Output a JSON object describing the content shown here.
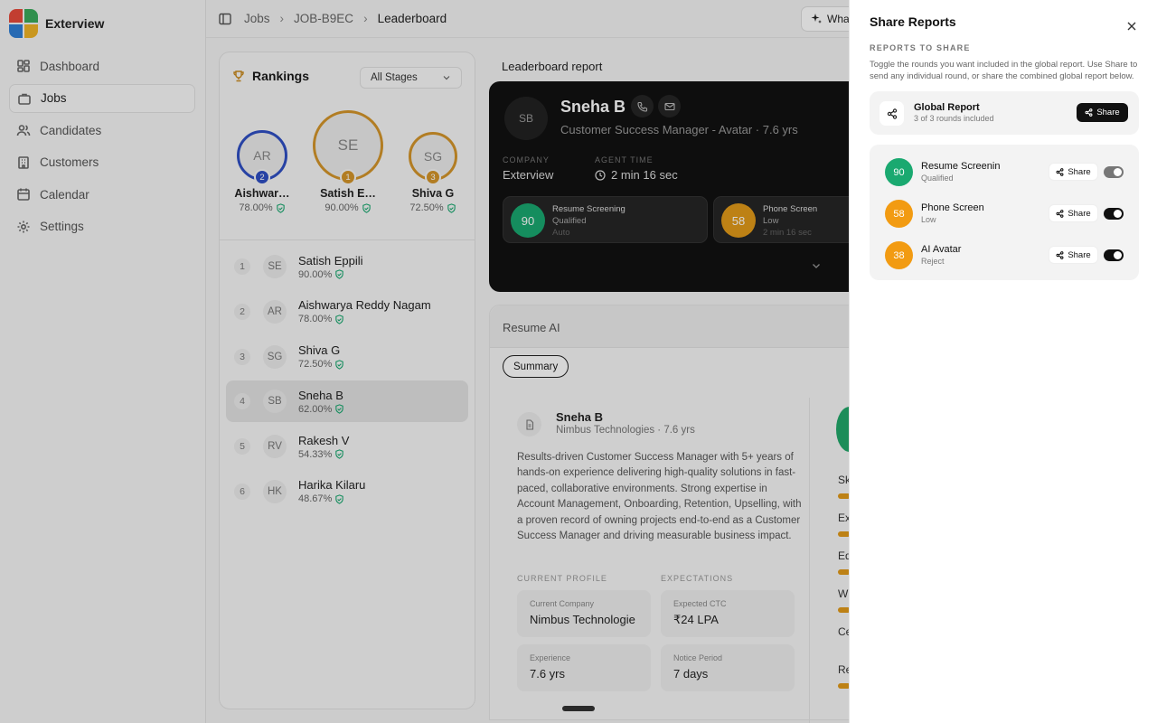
{
  "brand": {
    "name": "Exterview"
  },
  "nav": [
    {
      "label": "Dashboard",
      "icon": "dashboard-icon"
    },
    {
      "label": "Jobs",
      "icon": "briefcase-icon",
      "active": true
    },
    {
      "label": "Candidates",
      "icon": "users-icon"
    },
    {
      "label": "Customers",
      "icon": "building-icon"
    },
    {
      "label": "Calendar",
      "icon": "calendar-icon"
    },
    {
      "label": "Settings",
      "icon": "gear-icon"
    }
  ],
  "breadcrumb": {
    "items": [
      "Jobs",
      "JOB-B9EC",
      "Leaderboard"
    ]
  },
  "topbar": {
    "what_button": "Wha"
  },
  "rankings": {
    "title": "Rankings",
    "stage_select": "All Stages",
    "podium": [
      {
        "rank": "2",
        "initials": "AR",
        "name": "Aishwar…",
        "score": "78.00%"
      },
      {
        "rank": "1",
        "initials": "SE",
        "name": "Satish E…",
        "score": "90.00%"
      },
      {
        "rank": "3",
        "initials": "SG",
        "name": "Shiva G",
        "score": "72.50%"
      }
    ],
    "list": [
      {
        "rank": "1",
        "initials": "SE",
        "name": "Satish Eppili",
        "score": "90.00%"
      },
      {
        "rank": "2",
        "initials": "AR",
        "name": "Aishwarya Reddy Nagam",
        "score": "78.00%"
      },
      {
        "rank": "3",
        "initials": "SG",
        "name": "Shiva G",
        "score": "72.50%"
      },
      {
        "rank": "4",
        "initials": "SB",
        "name": "Sneha B",
        "score": "62.00%",
        "selected": true
      },
      {
        "rank": "5",
        "initials": "RV",
        "name": "Rakesh V",
        "score": "54.33%"
      },
      {
        "rank": "6",
        "initials": "HK",
        "name": "Harika Kilaru",
        "score": "48.67%"
      }
    ]
  },
  "leaderboard": {
    "title": "Leaderboard report",
    "candidate": {
      "initials": "SB",
      "name": "Sneha B",
      "role": "Customer Success Manager - Avatar · 7.6 yrs",
      "company_label": "COMPANY",
      "company": "Exterview",
      "agent_time_label": "AGENT TIME",
      "agent_time": "2 min 16 sec"
    },
    "rounds": [
      {
        "score": "90",
        "name": "Resume Screening",
        "status": "Qualified",
        "meta": "Auto",
        "color": "#1aa970"
      },
      {
        "score": "58",
        "name": "Phone Screen",
        "status": "Low",
        "meta": "2 min 16 sec",
        "color": "#e29a1a"
      }
    ]
  },
  "resume": {
    "title": "Resume AI",
    "tab": "Summary",
    "name": "Sneha B",
    "sub": "Nimbus Technologies · 7.6 yrs",
    "summary": "Results-driven Customer Success Manager with 5+ years of hands-on experience delivering high-quality solutions in fast-paced, collaborative environments. Strong expertise in Account Management, Onboarding, Retention, Upselling, with a proven record of owning projects end-to-end as a Customer Success Manager and driving measurable business impact.",
    "current_profile_label": "CURRENT PROFILE",
    "expectations_label": "EXPECTATIONS",
    "fields": [
      {
        "label": "Current Company",
        "value": "Nimbus Technologie"
      },
      {
        "label": "Expected CTC",
        "value": "₹24 LPA"
      },
      {
        "label": "Experience",
        "value": "7.6 yrs"
      },
      {
        "label": "Notice Period",
        "value": "7 days"
      }
    ],
    "side_labels": [
      "Sk",
      "Ex",
      "Ed",
      "W",
      "Ce",
      "Re"
    ]
  },
  "share_panel": {
    "title": "Share Reports",
    "section": "REPORTS TO SHARE",
    "description": "Toggle the rounds you want included in the global report. Use Share to send any individual round, or share the combined global report below.",
    "global": {
      "title": "Global Report",
      "sub": "3 of 3 rounds included",
      "button": "Share"
    },
    "rounds": [
      {
        "score": "90",
        "name": "Resume Screening",
        "status": "Qualified",
        "button": "Share",
        "color": "#1aa970",
        "enabled": true
      },
      {
        "score": "58",
        "name": "Phone Screen",
        "status": "Low",
        "button": "Share",
        "color": "#f29b12",
        "enabled": true
      },
      {
        "score": "38",
        "name": "AI Avatar",
        "status": "Reject",
        "button": "Share",
        "color": "#f29b12",
        "enabled": true
      }
    ]
  },
  "colors": {
    "gold": "#d4962a",
    "silver_blue": "#2f4fc4",
    "green": "#1aa970",
    "orange": "#f29b12"
  }
}
